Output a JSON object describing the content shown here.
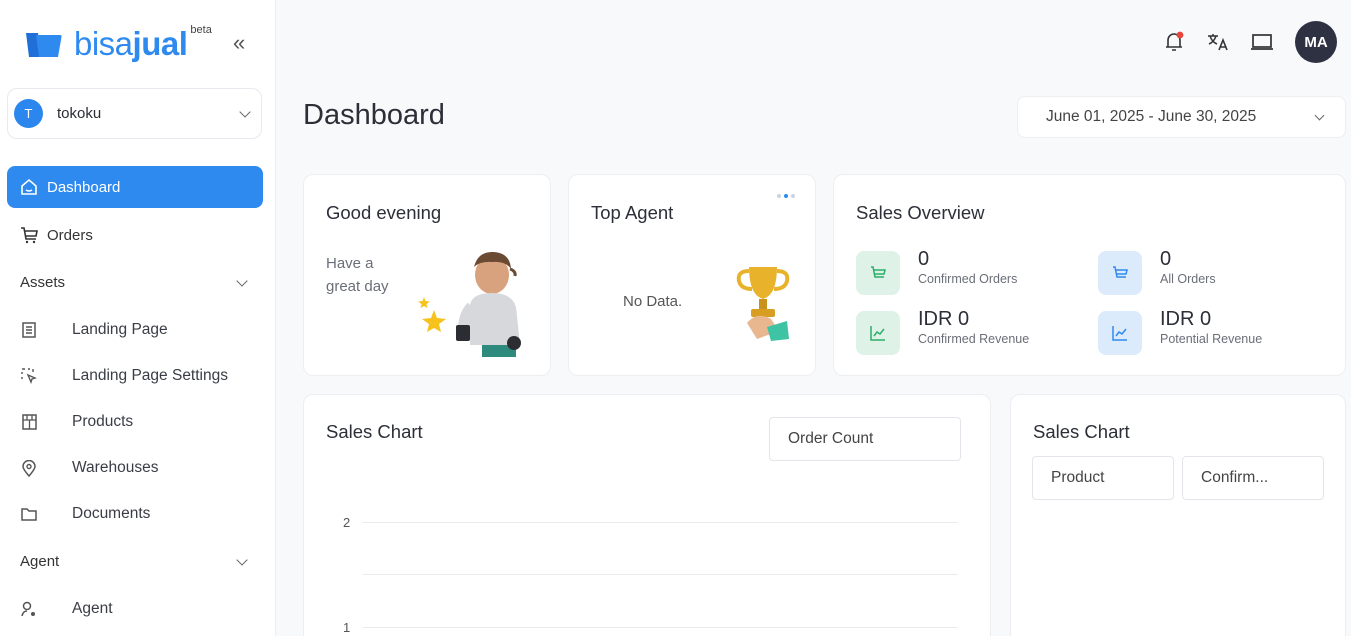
{
  "brand": {
    "name_light": "bisa",
    "name_bold": "jual",
    "badge": "beta",
    "collapse_icon": "double-chevron-left-icon"
  },
  "topbar_ghost": [
    "",
    ""
  ],
  "store": {
    "initial": "T",
    "name": "tokoku"
  },
  "sidebar": {
    "dashboard": "Dashboard",
    "orders": "Orders",
    "assets_section": "Assets",
    "assets_items": [
      "Landing Page",
      "Landing Page Settings",
      "Products",
      "Warehouses",
      "Documents"
    ],
    "agent_section": "Agent",
    "agent_items": [
      "Agent"
    ]
  },
  "header": {
    "avatar_initials": "MA"
  },
  "page": {
    "title": "Dashboard",
    "date_range": "June 01, 2025 - June 30, 2025"
  },
  "greeting": {
    "title": "Good evening",
    "line1": "Have a",
    "line2": "great day"
  },
  "top_agent": {
    "title": "Top Agent",
    "empty": "No Data."
  },
  "sales_overview": {
    "title": "Sales Overview",
    "stats": [
      {
        "value": "0",
        "label": "Confirmed Orders"
      },
      {
        "value": "0",
        "label": "All Orders"
      },
      {
        "value": "IDR 0",
        "label": "Confirmed Revenue"
      },
      {
        "value": "IDR 0",
        "label": "Potential Revenue"
      }
    ]
  },
  "sales_chart_main": {
    "title": "Sales Chart",
    "metric": "Order Count",
    "y_ticks": [
      "2",
      "1"
    ]
  },
  "sales_chart_side": {
    "title": "Sales Chart",
    "group_by": "Product",
    "status": "Confirm..."
  },
  "colors": {
    "accent": "#2f8af0",
    "green_tint": "#dff2e8",
    "blue_tint": "#dcebfb",
    "notification": "#e8453c"
  }
}
